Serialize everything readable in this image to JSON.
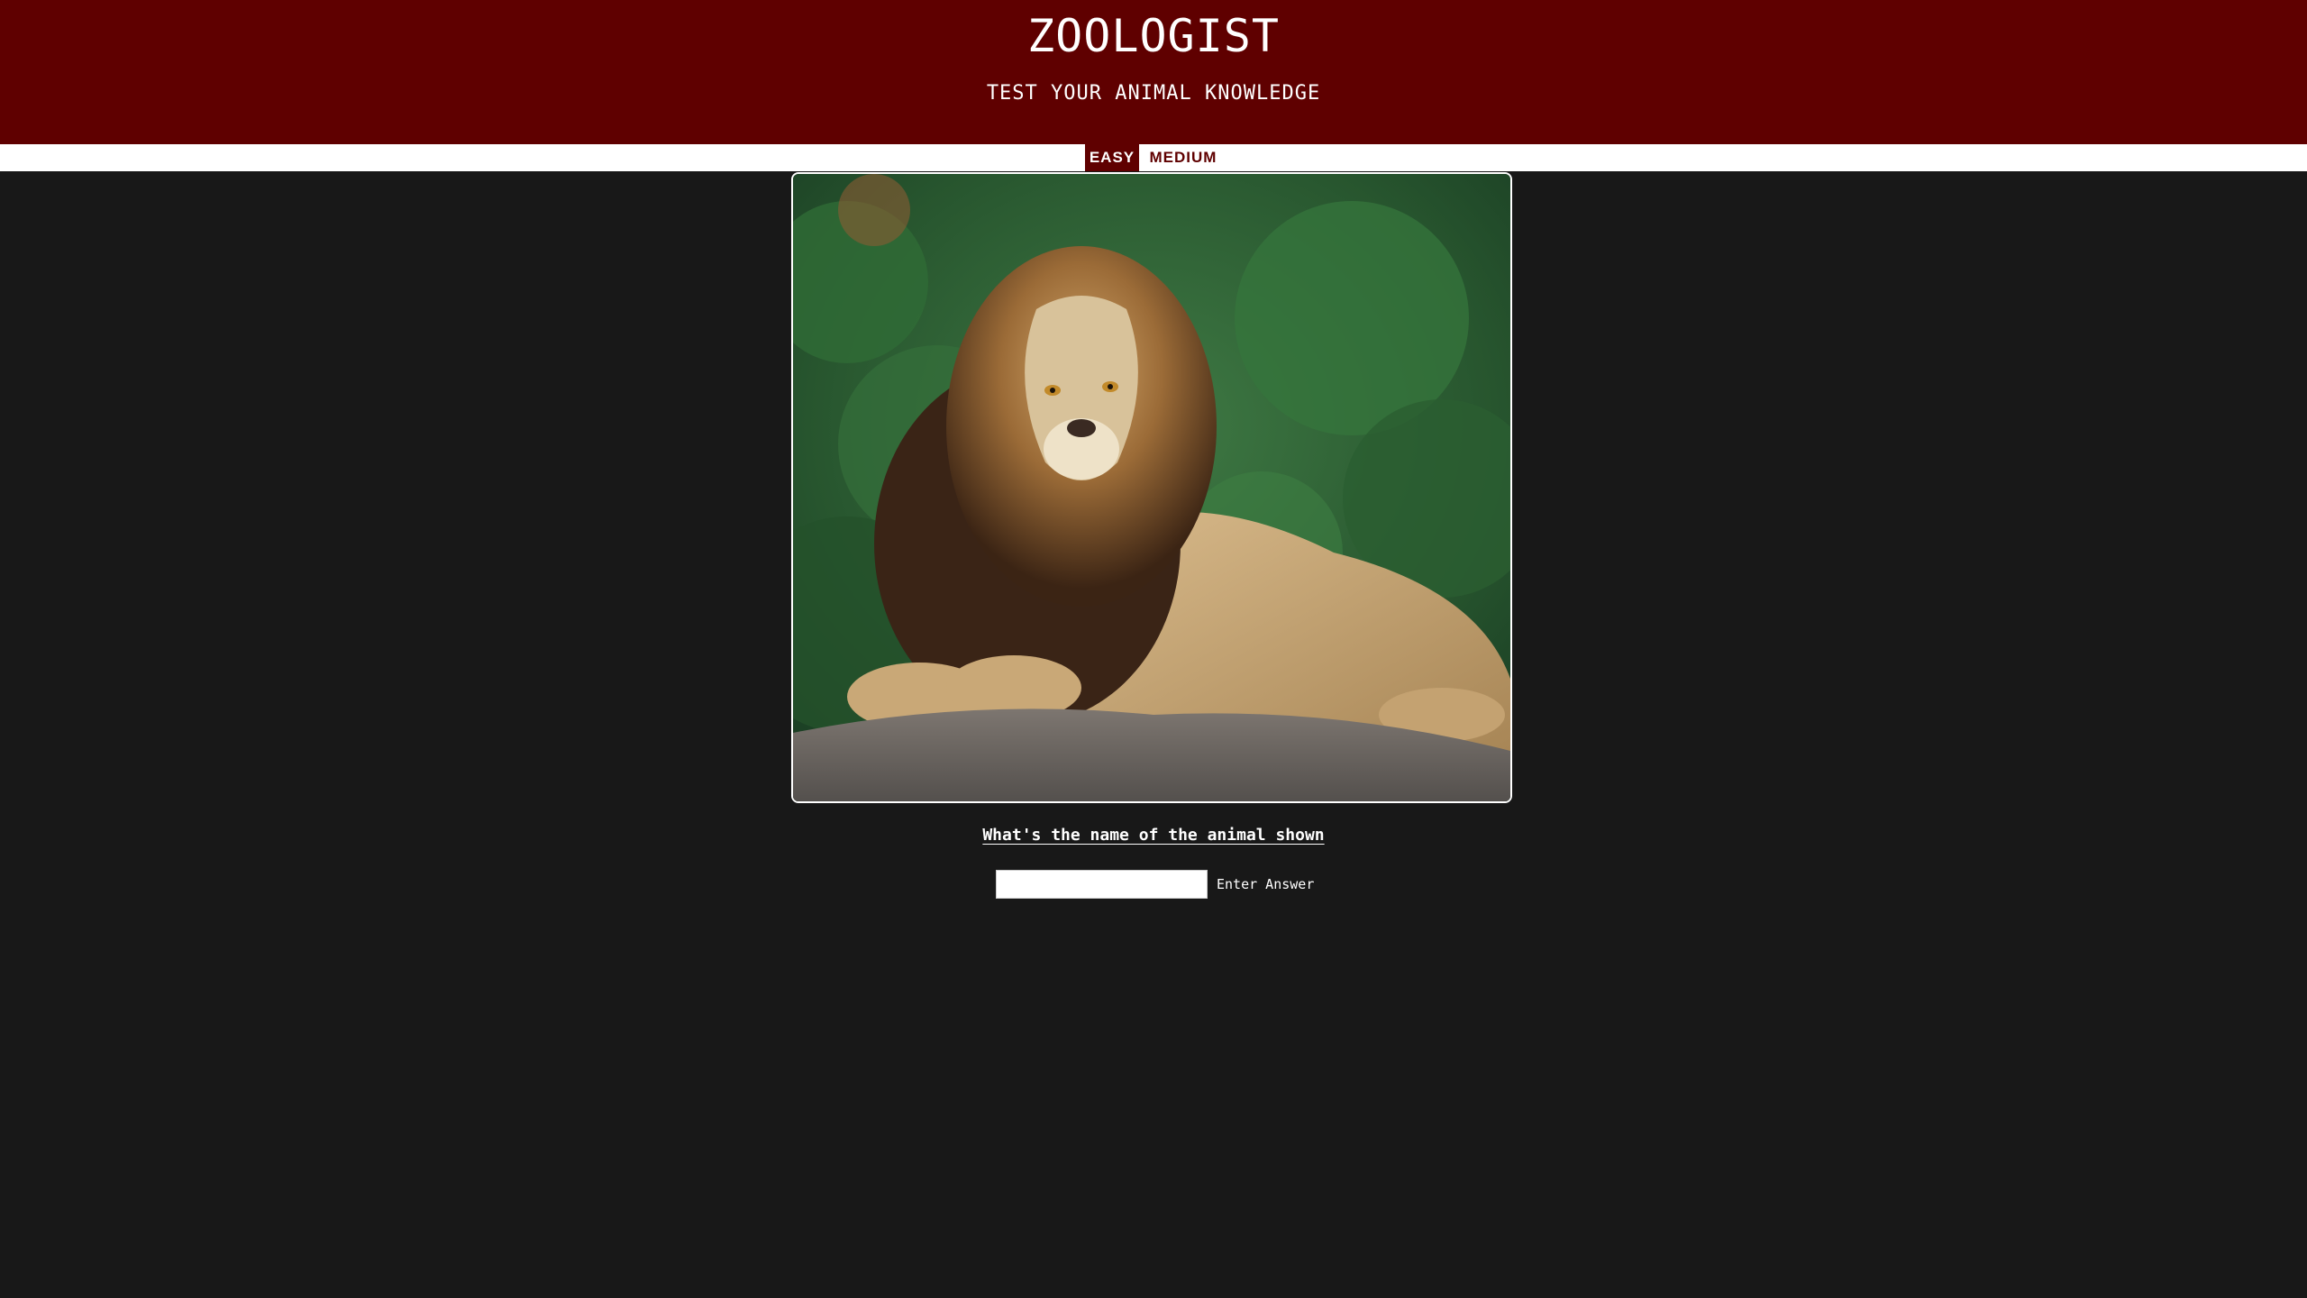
{
  "header": {
    "title": "ZOOLOGIST",
    "subtitle": "TEST YOUR ANIMAL KNOWLEDGE"
  },
  "tabs": [
    {
      "label": "EASY",
      "active": true
    },
    {
      "label": "MEDIUM",
      "active": false
    }
  ],
  "photo": {
    "subject": "lion-photo"
  },
  "quiz": {
    "question": "What's the name of the animal shown",
    "answer_value": "",
    "answer_placeholder": "",
    "submit_label": "Enter Answer"
  },
  "colors": {
    "brand": "#5f0000",
    "background": "#181818",
    "text": "#ffffff"
  }
}
